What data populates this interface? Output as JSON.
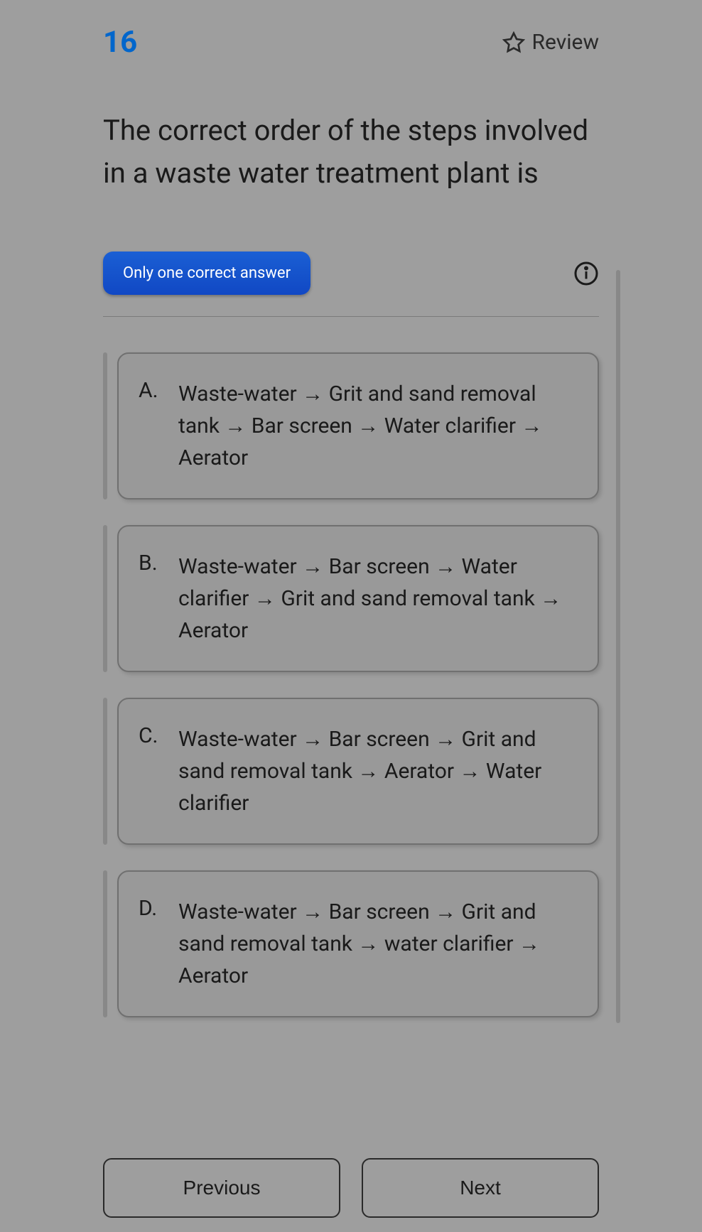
{
  "header": {
    "questionNumber": "16",
    "reviewLabel": "Review"
  },
  "question": {
    "text": "The correct order of the steps involved in a waste water treatment plant is"
  },
  "answerType": {
    "label": "Only one correct answer"
  },
  "options": [
    {
      "letter": "A.",
      "text": "Waste-water → Grit and sand removal tank → Bar screen → Water clarifier → Aerator"
    },
    {
      "letter": "B.",
      "text": "Waste-water → Bar screen → Water clarifier → Grit and sand removal tank → Aerator"
    },
    {
      "letter": "C.",
      "text": "Waste-water → Bar screen → Grit and sand removal tank → Aerator → Water clarifier"
    },
    {
      "letter": "D.",
      "text": "Waste-water → Bar screen → Grit and sand removal tank → water clarifier → Aerator"
    }
  ],
  "navigation": {
    "previousLabel": "Previous",
    "nextLabel": "Next"
  }
}
